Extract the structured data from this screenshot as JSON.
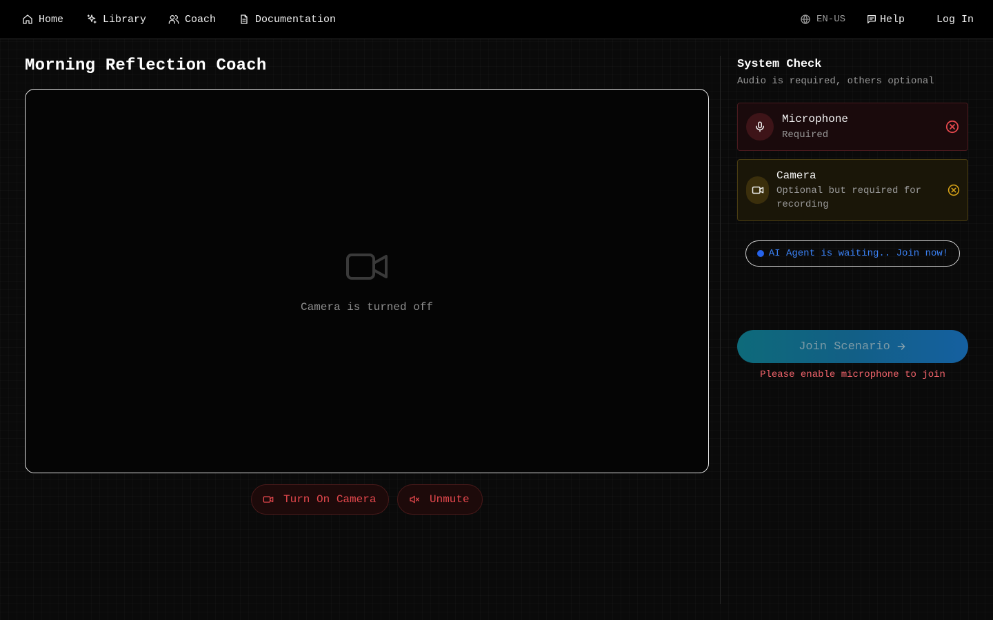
{
  "nav": {
    "home": "Home",
    "library": "Library",
    "coach": "Coach",
    "documentation": "Documentation",
    "language": "EN-US",
    "help": "Help",
    "login": "Log In"
  },
  "main": {
    "title": "Morning Reflection Coach",
    "camera_off_text": "Camera is turned off",
    "turn_on_camera": "Turn On Camera",
    "unmute": "Unmute"
  },
  "system_check": {
    "title": "System Check",
    "subtitle": "Audio is required, others optional",
    "microphone": {
      "title": "Microphone",
      "desc": "Required",
      "status": "error"
    },
    "camera": {
      "title": "Camera",
      "desc": "Optional but required for recording",
      "status": "warning"
    },
    "agent_status": "AI Agent is waiting.. Join now!",
    "join_button": "Join Scenario",
    "join_warning": "Please enable microphone to join"
  },
  "colors": {
    "background": "#0a0a0a",
    "error": "#e5484d",
    "warning": "#d4a017",
    "accent_blue": "#3b82f6",
    "join_gradient_start": "#0e6a7a",
    "join_gradient_end": "#1560a0"
  },
  "icons": [
    "home-icon",
    "sparkle-icon",
    "users-icon",
    "document-icon",
    "globe-icon",
    "message-icon",
    "video-camera-icon",
    "mute-icon",
    "microphone-icon",
    "x-circle-icon",
    "arrow-right-icon"
  ]
}
